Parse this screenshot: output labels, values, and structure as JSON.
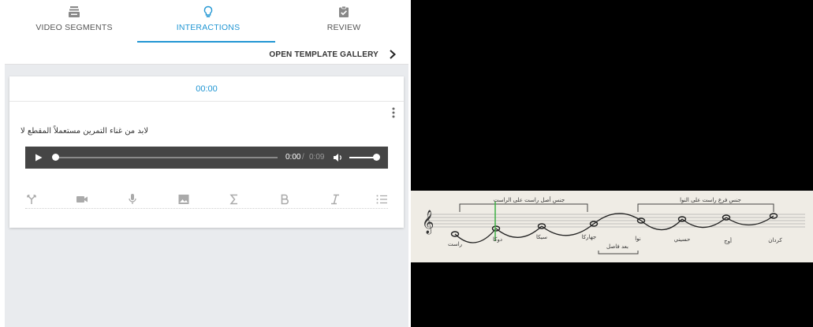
{
  "tabs": [
    {
      "label": "VIDEO SEGMENTS",
      "icon": "video-segments-icon"
    },
    {
      "label": "INTERACTIONS",
      "icon": "lightbulb-icon",
      "active": true
    },
    {
      "label": "REVIEW",
      "icon": "clipboard-check-icon"
    }
  ],
  "gallery": {
    "label": "OPEN TEMPLATE GALLERY",
    "icon": "chevron-right-icon"
  },
  "card": {
    "timestamp": "00:00",
    "question": "لابد من غناء التمرين مستعملاً المقطع لا",
    "audio": {
      "current": "0:00",
      "separator": "/",
      "duration": "0:09",
      "progress": 0,
      "volume": 1.0
    },
    "toolbar": [
      {
        "name": "branch-icon"
      },
      {
        "name": "video-camera-icon"
      },
      {
        "name": "microphone-icon"
      },
      {
        "name": "image-icon"
      },
      {
        "name": "sigma-icon"
      },
      {
        "name": "bold-icon"
      },
      {
        "name": "italic-icon"
      },
      {
        "name": "list-icon"
      }
    ]
  },
  "video": {
    "top_labels": [
      "جنس أصل راست على الراست",
      "جنس فرع راست على النوا"
    ],
    "note_labels": [
      "راست",
      "دوكا",
      "سيكا",
      "جهاركا",
      "نوا",
      "حسيني",
      "أوج",
      "كردان"
    ],
    "bottom_label": "بعد فاصل"
  },
  "colors": {
    "accent": "#2196d3",
    "panel_bg": "#e9ebee",
    "audio_bg": "#454545",
    "sheet_bg": "#efece5",
    "marker": "#3cb043"
  }
}
